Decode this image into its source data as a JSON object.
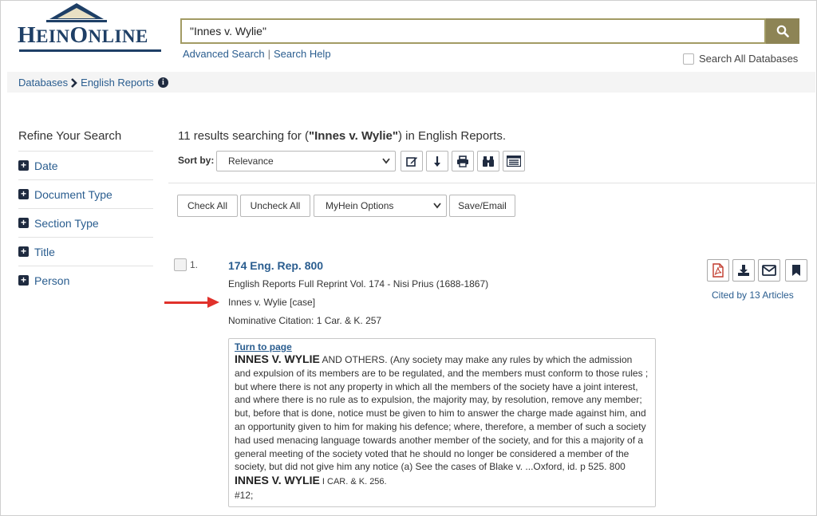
{
  "logo": {
    "text": "HeinOnline"
  },
  "search": {
    "value": "\"Innes v. Wylie\"",
    "advanced_link": "Advanced Search",
    "separator": "|",
    "help_link": "Search Help",
    "search_all_label": "Search All Databases"
  },
  "breadcrumb": {
    "root": "Databases",
    "current": "English Reports"
  },
  "sidebar": {
    "title": "Refine Your Search",
    "facets": [
      "Date",
      "Document Type",
      "Section Type",
      "Title",
      "Person"
    ]
  },
  "results": {
    "count": "11",
    "pre": " results searching for (",
    "query": "\"Innes v. Wylie\"",
    "post": ") in English Reports."
  },
  "sort": {
    "label": "Sort by:",
    "value": "Relevance"
  },
  "toolbar": {
    "check_all": "Check All",
    "uncheck_all": "Uncheck All",
    "myhein": "MyHein Options",
    "save_email": "Save/Email"
  },
  "result_item": {
    "number": "1.",
    "title": "174 Eng. Rep. 800",
    "source": "English Reports Full Reprint Vol. 174 - Nisi Prius (1688-1867)",
    "case_name": "Innes v. Wylie [case]",
    "nominative": "Nominative Citation: 1 Car. & K. 257",
    "cited_by": "Cited by 13 Articles",
    "snippet": {
      "turn_to_page": "Turn to page",
      "hl1": "INNES V. WYLIE",
      "text1": " AND OTHERS. (Any society may make any rules by which the admission and expulsion of its members are to be regulated, and the members must conform to those rules ; but where there is not any property in which all the members of the society have a joint interest, and where there is no rule as to expulsion, the majority may, by resolution, remove any member; but, before that is done, notice must be given to him to answer the charge made against him, and an opportunity given to him for making his defence; where, therefore, a member of such a society had used menacing language towards another member of the society, and for this a majority of a general meeting of the society voted that he should no longer be considered a member of the society, but did not give him any notice (a) See the cases of Blake v. ...Oxford, id. p 525. 800 ",
      "hl2": "INNES V. WYLIE",
      "text2": " I CAR. & K. 256.",
      "text3": "#12;"
    }
  },
  "colors": {
    "brand": "#1e3f66",
    "link": "#2a5d8f",
    "search_button": "#8d8455",
    "annotation_arrow": "#e0312b",
    "pdf_red": "#c0392b"
  }
}
